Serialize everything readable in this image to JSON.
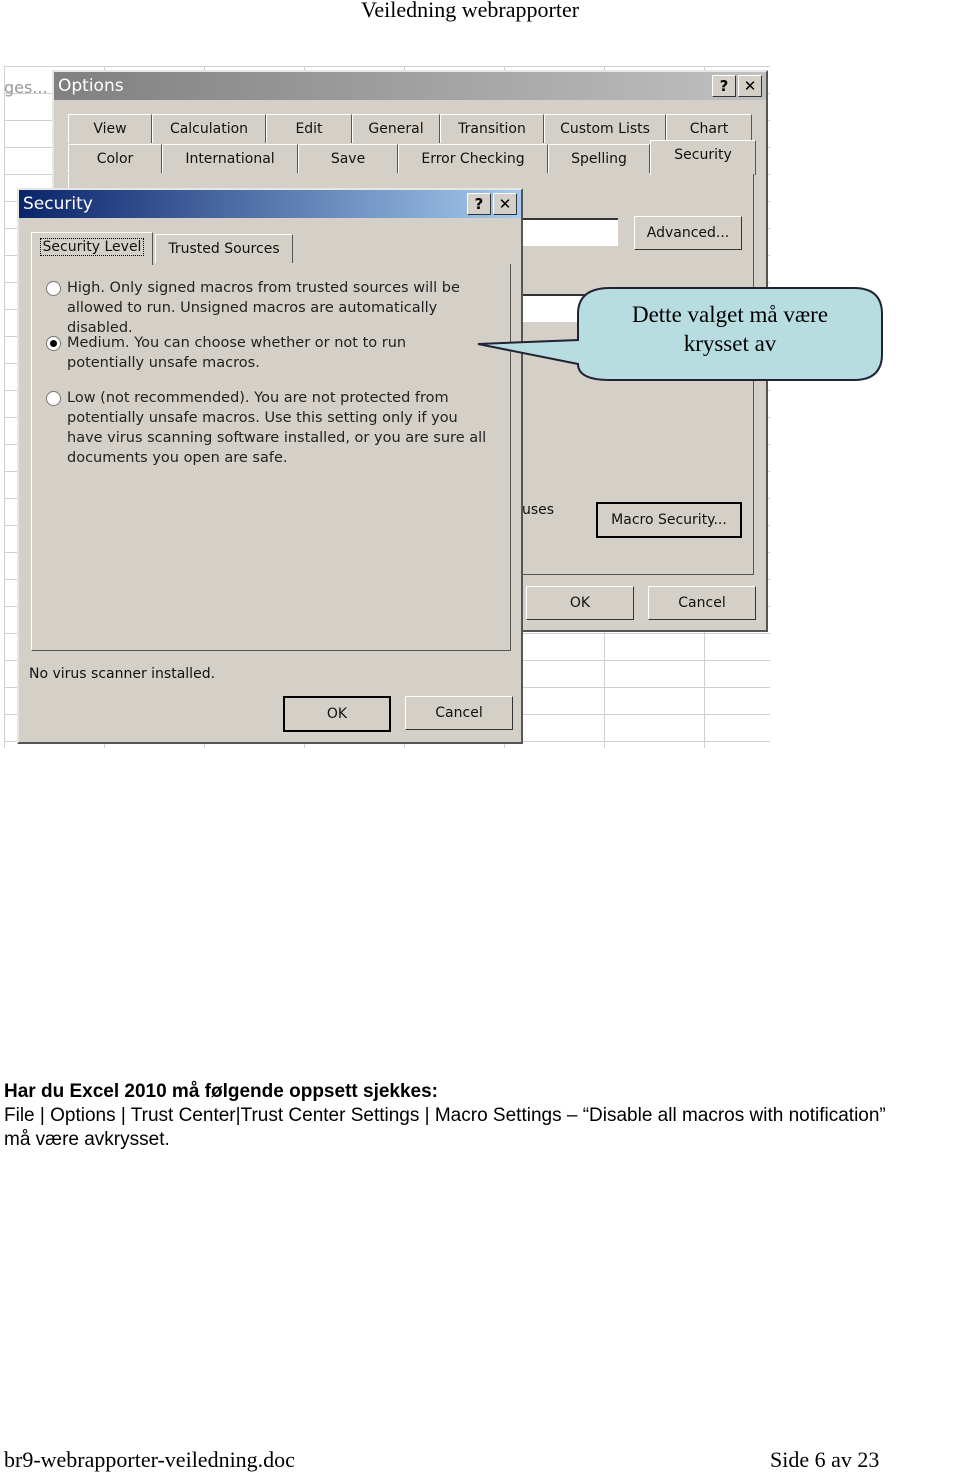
{
  "header": {
    "title": "Veiledning webrapporter"
  },
  "screenshot": {
    "background_text": "ges...",
    "options": {
      "title": "Options",
      "help": "?",
      "close": "✕",
      "tabs_row1": [
        "View",
        "Calculation",
        "Edit",
        "General",
        "Transition",
        "Custom Lists",
        "Chart"
      ],
      "tabs_row2": [
        "Color",
        "International",
        "Save",
        "Error Checking",
        "Spelling",
        "Security"
      ],
      "advanced": "Advanced...",
      "uses": "uses",
      "macro_security": "Macro Security...",
      "ok": "OK",
      "cancel": "Cancel"
    },
    "security": {
      "title": "Security",
      "help": "?",
      "close": "✕",
      "tabs": [
        "Security Level",
        "Trusted Sources"
      ],
      "options": [
        {
          "label": "High. Only signed macros from trusted sources will be allowed to run. Unsigned macros are automatically disabled.",
          "selected": false
        },
        {
          "label": "Medium. You can choose whether or not to run potentially unsafe macros.",
          "selected": true
        },
        {
          "label": "Low (not recommended). You are not protected from potentially unsafe macros. Use this setting only if you have virus scanning software installed, or you are sure all documents you open are safe.",
          "selected": false
        }
      ],
      "status": "No virus scanner installed.",
      "ok": "OK",
      "cancel": "Cancel"
    },
    "callout": {
      "text": "Dette valget må være krysset av",
      "color": "#b7dde0"
    }
  },
  "body": {
    "heading": "Har du Excel 2010 må følgende oppsett sjekkes:",
    "line1": "File | Options | Trust Center|Trust Center Settings | Macro Settings – “Disable all macros with notification”",
    "line2": "må være avkrysset."
  },
  "footer": {
    "filename": "br9-webrapporter-veiledning.doc",
    "page": "Side 6 av 23"
  }
}
